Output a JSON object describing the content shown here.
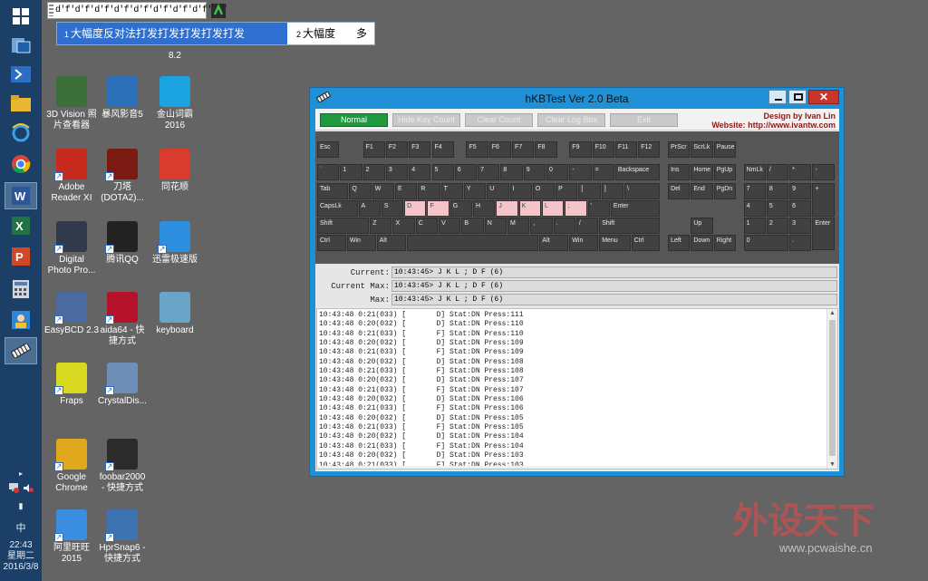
{
  "tray": {
    "time": "22:43",
    "weekday": "星期二",
    "date": "2016/3/8",
    "ime_lang": "中"
  },
  "ime": {
    "composition": "d'f'd'f'd'f'd'f'd'f'd'f'd'f'd'f'd'f",
    "candidates": [
      {
        "num": "1",
        "text": "大幅度反对法打发打发打发打发打发"
      },
      {
        "num": "2",
        "text": "大幅度"
      },
      {
        "num": "",
        "text": "多发"
      }
    ]
  },
  "desktop": {
    "hidden_label": "8.2",
    "icons": [
      {
        "label": "3D Vision 照\n片查看器",
        "color": "#3c6e3a",
        "shortcut": false
      },
      {
        "label": "暴风影音5",
        "color": "#2a6fb8",
        "shortcut": false
      },
      {
        "label": "金山词霸\n2016",
        "color": "#1aa3e0",
        "shortcut": false
      },
      {
        "label": "Adobe\nReader XI",
        "color": "#c62a1c",
        "shortcut": true
      },
      {
        "label": "刀塔\n(DOTA2)...",
        "color": "#7a1a12",
        "shortcut": true
      },
      {
        "label": "同花顺",
        "color": "#d93b2c",
        "shortcut": false
      },
      {
        "label": "Digital\nPhoto Pro...",
        "color": "#303a4a",
        "shortcut": true
      },
      {
        "label": "腾讯QQ",
        "color": "#222222",
        "shortcut": true
      },
      {
        "label": "迅雷极速版",
        "color": "#2c8fe0",
        "shortcut": true
      },
      {
        "label": "EasyBCD 2.3",
        "color": "#4a6aa0",
        "shortcut": true
      },
      {
        "label": "aida64 - 快\n捷方式",
        "color": "#b3122a",
        "shortcut": true
      },
      {
        "label": "keyboard",
        "color": "#6aa5c8",
        "shortcut": false
      },
      {
        "label": "Fraps",
        "color": "#d8d820",
        "shortcut": true
      },
      {
        "label": "CrystalDis...",
        "color": "#6f8eb8",
        "shortcut": true
      },
      {
        "label": "Google\nChrome",
        "color": "#e0a81c",
        "shortcut": true
      },
      {
        "label": "foobar2000\n- 快捷方式",
        "color": "#2b2b2b",
        "shortcut": true
      },
      {
        "label": "阿里旺旺\n2015",
        "color": "#3a8ee0",
        "shortcut": true
      },
      {
        "label": "HprSnap6 -\n快捷方式",
        "color": "#3d73b0",
        "shortcut": true
      }
    ]
  },
  "window": {
    "title": "hKBTest Ver 2.0 Beta",
    "toolbar": {
      "normal": "Normal",
      "hide_key_count": "Hide Key Count",
      "clear_count": "Clear Count",
      "clear_log_box": "Clear Log Box",
      "exit": "Exit"
    },
    "credit": {
      "design": "Design by Ivan Lin",
      "website": "Website: http://www.ivantw.com"
    },
    "keys": [
      {
        "row": 0,
        "label": "Esc"
      },
      {
        "row": 0,
        "label": "F1"
      },
      {
        "row": 0,
        "label": "F2"
      },
      {
        "row": 0,
        "label": "F3"
      },
      {
        "row": 0,
        "label": "F4"
      },
      {
        "row": 0,
        "label": "F5"
      },
      {
        "row": 0,
        "label": "F6"
      },
      {
        "row": 0,
        "label": "F7"
      },
      {
        "row": 0,
        "label": "F8"
      },
      {
        "row": 0,
        "label": "F9"
      },
      {
        "row": 0,
        "label": "F10"
      },
      {
        "row": 0,
        "label": "F11"
      },
      {
        "row": 0,
        "label": "F12"
      },
      {
        "row": 0,
        "label": "PrScr"
      },
      {
        "row": 0,
        "label": "ScrLk"
      },
      {
        "row": 0,
        "label": "Pause"
      },
      {
        "row": 1,
        "label": "`"
      },
      {
        "row": 1,
        "label": "1"
      },
      {
        "row": 1,
        "label": "2"
      },
      {
        "row": 1,
        "label": "3"
      },
      {
        "row": 1,
        "label": "4"
      },
      {
        "row": 1,
        "label": "5"
      },
      {
        "row": 1,
        "label": "6"
      },
      {
        "row": 1,
        "label": "7"
      },
      {
        "row": 1,
        "label": "8"
      },
      {
        "row": 1,
        "label": "9"
      },
      {
        "row": 1,
        "label": "0"
      },
      {
        "row": 1,
        "label": "-"
      },
      {
        "row": 1,
        "label": "="
      },
      {
        "row": 1,
        "label": "Backspace"
      },
      {
        "row": 1,
        "label": "Ins"
      },
      {
        "row": 1,
        "label": "Home"
      },
      {
        "row": 1,
        "label": "PgUp"
      },
      {
        "row": 1,
        "label": "NmLk"
      },
      {
        "row": 1,
        "label": "/"
      },
      {
        "row": 1,
        "label": "*"
      },
      {
        "row": 1,
        "label": "-"
      },
      {
        "row": 2,
        "label": "Tab"
      },
      {
        "row": 2,
        "label": "Q"
      },
      {
        "row": 2,
        "label": "W"
      },
      {
        "row": 2,
        "label": "E"
      },
      {
        "row": 2,
        "label": "R"
      },
      {
        "row": 2,
        "label": "T"
      },
      {
        "row": 2,
        "label": "Y"
      },
      {
        "row": 2,
        "label": "U"
      },
      {
        "row": 2,
        "label": "I"
      },
      {
        "row": 2,
        "label": "O"
      },
      {
        "row": 2,
        "label": "P"
      },
      {
        "row": 2,
        "label": "["
      },
      {
        "row": 2,
        "label": "]"
      },
      {
        "row": 2,
        "label": "\\"
      },
      {
        "row": 2,
        "label": "Del"
      },
      {
        "row": 2,
        "label": "End"
      },
      {
        "row": 2,
        "label": "PgDn"
      },
      {
        "row": 2,
        "label": "7"
      },
      {
        "row": 2,
        "label": "8"
      },
      {
        "row": 2,
        "label": "9"
      },
      {
        "row": 2,
        "label": "+"
      },
      {
        "row": 3,
        "label": "CapsLk"
      },
      {
        "row": 3,
        "label": "A"
      },
      {
        "row": 3,
        "label": "S"
      },
      {
        "row": 3,
        "label": "D",
        "pressed": true
      },
      {
        "row": 3,
        "label": "F",
        "pressed": true
      },
      {
        "row": 3,
        "label": "G"
      },
      {
        "row": 3,
        "label": "H"
      },
      {
        "row": 3,
        "label": "J",
        "pressed": true
      },
      {
        "row": 3,
        "label": "K",
        "pressed": true
      },
      {
        "row": 3,
        "label": "L",
        "pressed": true
      },
      {
        "row": 3,
        "label": ";",
        "pressed": true
      },
      {
        "row": 3,
        "label": "'"
      },
      {
        "row": 3,
        "label": "Enter"
      },
      {
        "row": 3,
        "label": "4"
      },
      {
        "row": 3,
        "label": "5"
      },
      {
        "row": 3,
        "label": "6"
      },
      {
        "row": 4,
        "label": "Shift"
      },
      {
        "row": 4,
        "label": "Z"
      },
      {
        "row": 4,
        "label": "X"
      },
      {
        "row": 4,
        "label": "C"
      },
      {
        "row": 4,
        "label": "V"
      },
      {
        "row": 4,
        "label": "B"
      },
      {
        "row": 4,
        "label": "N"
      },
      {
        "row": 4,
        "label": "M"
      },
      {
        "row": 4,
        "label": ","
      },
      {
        "row": 4,
        "label": "."
      },
      {
        "row": 4,
        "label": "/"
      },
      {
        "row": 4,
        "label": "Shift"
      },
      {
        "row": 4,
        "label": "Up"
      },
      {
        "row": 4,
        "label": "1"
      },
      {
        "row": 4,
        "label": "2"
      },
      {
        "row": 4,
        "label": "3"
      },
      {
        "row": 4,
        "label": "Enter"
      },
      {
        "row": 5,
        "label": "Ctrl"
      },
      {
        "row": 5,
        "label": "Win"
      },
      {
        "row": 5,
        "label": "Alt"
      },
      {
        "row": 5,
        "label": ""
      },
      {
        "row": 5,
        "label": "Alt"
      },
      {
        "row": 5,
        "label": "Win"
      },
      {
        "row": 5,
        "label": "Menu"
      },
      {
        "row": 5,
        "label": "Ctrl"
      },
      {
        "row": 5,
        "label": "Left"
      },
      {
        "row": 5,
        "label": "Down"
      },
      {
        "row": 5,
        "label": "Right"
      },
      {
        "row": 5,
        "label": "0"
      },
      {
        "row": 5,
        "label": "."
      }
    ],
    "readouts": [
      {
        "label": "Current:",
        "value": "10:43:45> J K L ; D F (6)"
      },
      {
        "label": "Current Max:",
        "value": "10:43:45> J K L ; D F (6)"
      },
      {
        "label": "Max:",
        "value": "10:43:45> J K L ; D F (6)"
      }
    ],
    "log": [
      "10:43:48 0:21(033) [       D] Stat:DN Press:111",
      "10:43:48 0:20(032) [       D] Stat:DN Press:110",
      "10:43:48 0:21(033) [       F] Stat:DN Press:110",
      "10:43:48 0:20(032) [       D] Stat:DN Press:109",
      "10:43:48 0:21(033) [       F] Stat:DN Press:109",
      "10:43:48 0:20(032) [       D] Stat:DN Press:108",
      "10:43:48 0:21(033) [       F] Stat:DN Press:108",
      "10:43:48 0:20(032) [       D] Stat:DN Press:107",
      "10:43:48 0:21(033) [       F] Stat:DN Press:107",
      "10:43:48 0:20(032) [       D] Stat:DN Press:106",
      "10:43:48 0:21(033) [       F] Stat:DN Press:106",
      "10:43:48 0:20(032) [       D] Stat:DN Press:105",
      "10:43:48 0:21(033) [       F] Stat:DN Press:105",
      "10:43:48 0:20(032) [       D] Stat:DN Press:104",
      "10:43:48 0:21(033) [       F] Stat:DN Press:104",
      "10:43:48 0:20(032) [       D] Stat:DN Press:103",
      "10:43:48 0:21(033) [       F] Stat:DN Press:103"
    ]
  },
  "watermark": {
    "brand": "外设天下",
    "url": "www.pcwaishe.cn"
  }
}
